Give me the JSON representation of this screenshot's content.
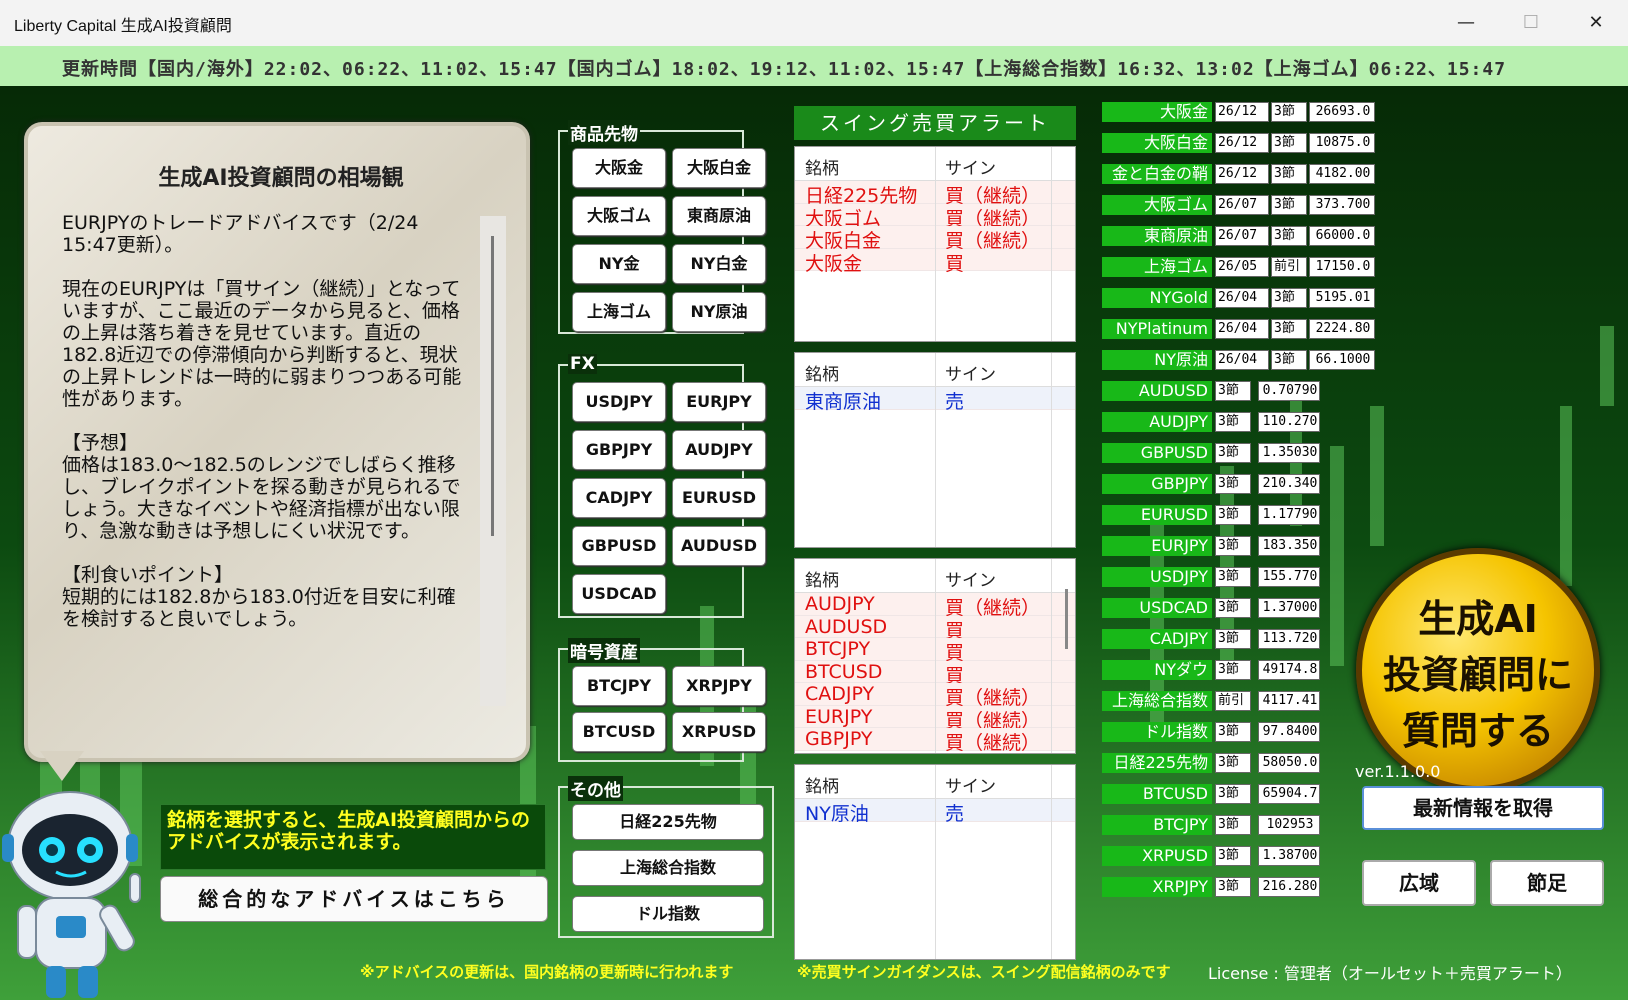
{
  "window": {
    "title": "Liberty Capital 生成AI投資顧問",
    "min": "—",
    "max": "☐",
    "close": "✕"
  },
  "update_bar": "更新時間【国内/海外】22:02、06:22、11:02、15:47【国内ゴム】18:02、19:12、11:02、15:47【上海総合指数】16:32、13:02【上海ゴム】06:22、15:47",
  "advice": {
    "title": "生成AI投資顧問の相場観",
    "text": "EURJPYのトレードアドバイスです（2/24 15:47更新）。\n\n現在のEURJPYは「買サイン（継続）」となっていますが、ここ最近のデータから見ると、価格の上昇は落ち着きを見せています。直近の182.8近辺での停滞傾向から判断すると、現状の上昇トレンドは一時的に弱まりつつある可能性があります。\n\n【予想】\n価格は183.0～182.5のレンジでしばらく推移し、ブレイクポイントを探る動きが見られるでしょう。大きなイベントや経済指標が出ない限り、急激な動きは予想しにくい状況です。\n\n【利食いポイント】\n短期的には182.8から183.0付近を目安に利確を検討すると良いでしょう。"
  },
  "instruction": "銘柄を選択すると、生成AI投資顧問からのアドバイスが表示されます。",
  "overall_button": "総合的なアドバイスはこちら",
  "groups": {
    "commodity": {
      "label": "商品先物",
      "buttons": [
        "大阪金",
        "大阪白金",
        "大阪ゴム",
        "東商原油",
        "NY金",
        "NY白金",
        "上海ゴム",
        "NY原油"
      ]
    },
    "fx": {
      "label": "FX",
      "buttons": [
        "USDJPY",
        "EURJPY",
        "GBPJPY",
        "AUDJPY",
        "CADJPY",
        "EURUSD",
        "GBPUSD",
        "AUDUSD",
        "USDCAD"
      ]
    },
    "crypto": {
      "label": "暗号資産",
      "buttons": [
        "BTCJPY",
        "XRPJPY",
        "BTCUSD",
        "XRPUSD"
      ]
    },
    "other": {
      "label": "その他",
      "buttons": [
        "日経225先物",
        "上海総合指数",
        "ドル指数"
      ]
    }
  },
  "alert": {
    "header": "スイング売買アラート",
    "col_name": "銘柄",
    "col_sign": "サイン",
    "tables": [
      {
        "rows": [
          {
            "name": "日経225先物",
            "sign": "買（継続）",
            "type": "buy"
          },
          {
            "name": "大阪ゴム",
            "sign": "買（継続）",
            "type": "buy"
          },
          {
            "name": "大阪白金",
            "sign": "買（継続）",
            "type": "buy"
          },
          {
            "name": "大阪金",
            "sign": "買",
            "type": "buy"
          }
        ]
      },
      {
        "rows": [
          {
            "name": "東商原油",
            "sign": "売",
            "type": "sell"
          }
        ]
      },
      {
        "rows": [
          {
            "name": "AUDJPY",
            "sign": "買（継続）",
            "type": "buy"
          },
          {
            "name": "AUDUSD",
            "sign": "買",
            "type": "buy"
          },
          {
            "name": "BTCJPY",
            "sign": "買",
            "type": "buy"
          },
          {
            "name": "BTCUSD",
            "sign": "買",
            "type": "buy"
          },
          {
            "name": "CADJPY",
            "sign": "買（継続）",
            "type": "buy"
          },
          {
            "name": "EURJPY",
            "sign": "買（継続）",
            "type": "buy"
          },
          {
            "name": "GBPJPY",
            "sign": "買（継続）",
            "type": "buy"
          }
        ]
      },
      {
        "rows": [
          {
            "name": "NY原油",
            "sign": "売",
            "type": "sell"
          }
        ]
      }
    ]
  },
  "quotes": [
    {
      "name": "大阪金",
      "contract": "26/12",
      "session": "3節",
      "price": "26693.0"
    },
    {
      "name": "大阪白金",
      "contract": "26/12",
      "session": "3節",
      "price": "10875.0"
    },
    {
      "name": "金と白金の鞘",
      "contract": "26/12",
      "session": "3節",
      "price": "4182.00"
    },
    {
      "name": "大阪ゴム",
      "contract": "26/07",
      "session": "3節",
      "price": "373.700"
    },
    {
      "name": "東商原油",
      "contract": "26/07",
      "session": "3節",
      "price": "66000.0"
    },
    {
      "name": "上海ゴム",
      "contract": "26/05",
      "session": "前引",
      "price": "17150.0"
    },
    {
      "name": "NYGold",
      "contract": "26/04",
      "session": "3節",
      "price": "5195.01"
    },
    {
      "name": "NYPlatinum",
      "contract": "26/04",
      "session": "3節",
      "price": "2224.80"
    },
    {
      "name": "NY原油",
      "contract": "26/04",
      "session": "3節",
      "price": "66.1000"
    },
    {
      "name": "AUDUSD",
      "session": "3節",
      "price": "0.70790"
    },
    {
      "name": "AUDJPY",
      "session": "3節",
      "price": "110.270"
    },
    {
      "name": "GBPUSD",
      "session": "3節",
      "price": "1.35030"
    },
    {
      "name": "GBPJPY",
      "session": "3節",
      "price": "210.340"
    },
    {
      "name": "EURUSD",
      "session": "3節",
      "price": "1.17790"
    },
    {
      "name": "EURJPY",
      "session": "3節",
      "price": "183.350"
    },
    {
      "name": "USDJPY",
      "session": "3節",
      "price": "155.770"
    },
    {
      "name": "USDCAD",
      "session": "3節",
      "price": "1.37000"
    },
    {
      "name": "CADJPY",
      "session": "3節",
      "price": "113.720"
    },
    {
      "name": "NYダウ",
      "session": "3節",
      "price": "49174.8"
    },
    {
      "name": "上海総合指数",
      "session": "前引",
      "price": "4117.41"
    },
    {
      "name": "ドル指数",
      "session": "3節",
      "price": "97.8400"
    },
    {
      "name": "日経225先物",
      "session": "3節",
      "price": "58050.0"
    },
    {
      "name": "BTCUSD",
      "session": "3節",
      "price": "65904.7"
    },
    {
      "name": "BTCJPY",
      "session": "3節",
      "price": "102953"
    },
    {
      "name": "XRPUSD",
      "session": "3節",
      "price": "1.38700"
    },
    {
      "name": "XRPJPY",
      "session": "3節",
      "price": "216.280"
    }
  ],
  "gold_button": {
    "line1": "生成AI",
    "line2": "投資顧問に",
    "line3": "質問する"
  },
  "version": "ver.1.1.0.0",
  "buttons": {
    "refresh": "最新情報を取得",
    "wide": "広域",
    "setsu": "節足"
  },
  "footer": {
    "note1": "※アドバイスの更新は、国内銘柄の更新時に行われます",
    "note2": "※売買サインガイダンスは、スイング配信銘柄のみです",
    "license": "License : 管理者（オールセット＋売買アラート）"
  },
  "colors": {
    "buy": "#e01010",
    "sell": "#1030d0",
    "accent_green": "#18b818",
    "header_green": "#1a8a1a",
    "update_bar": "#b8f0b0"
  }
}
